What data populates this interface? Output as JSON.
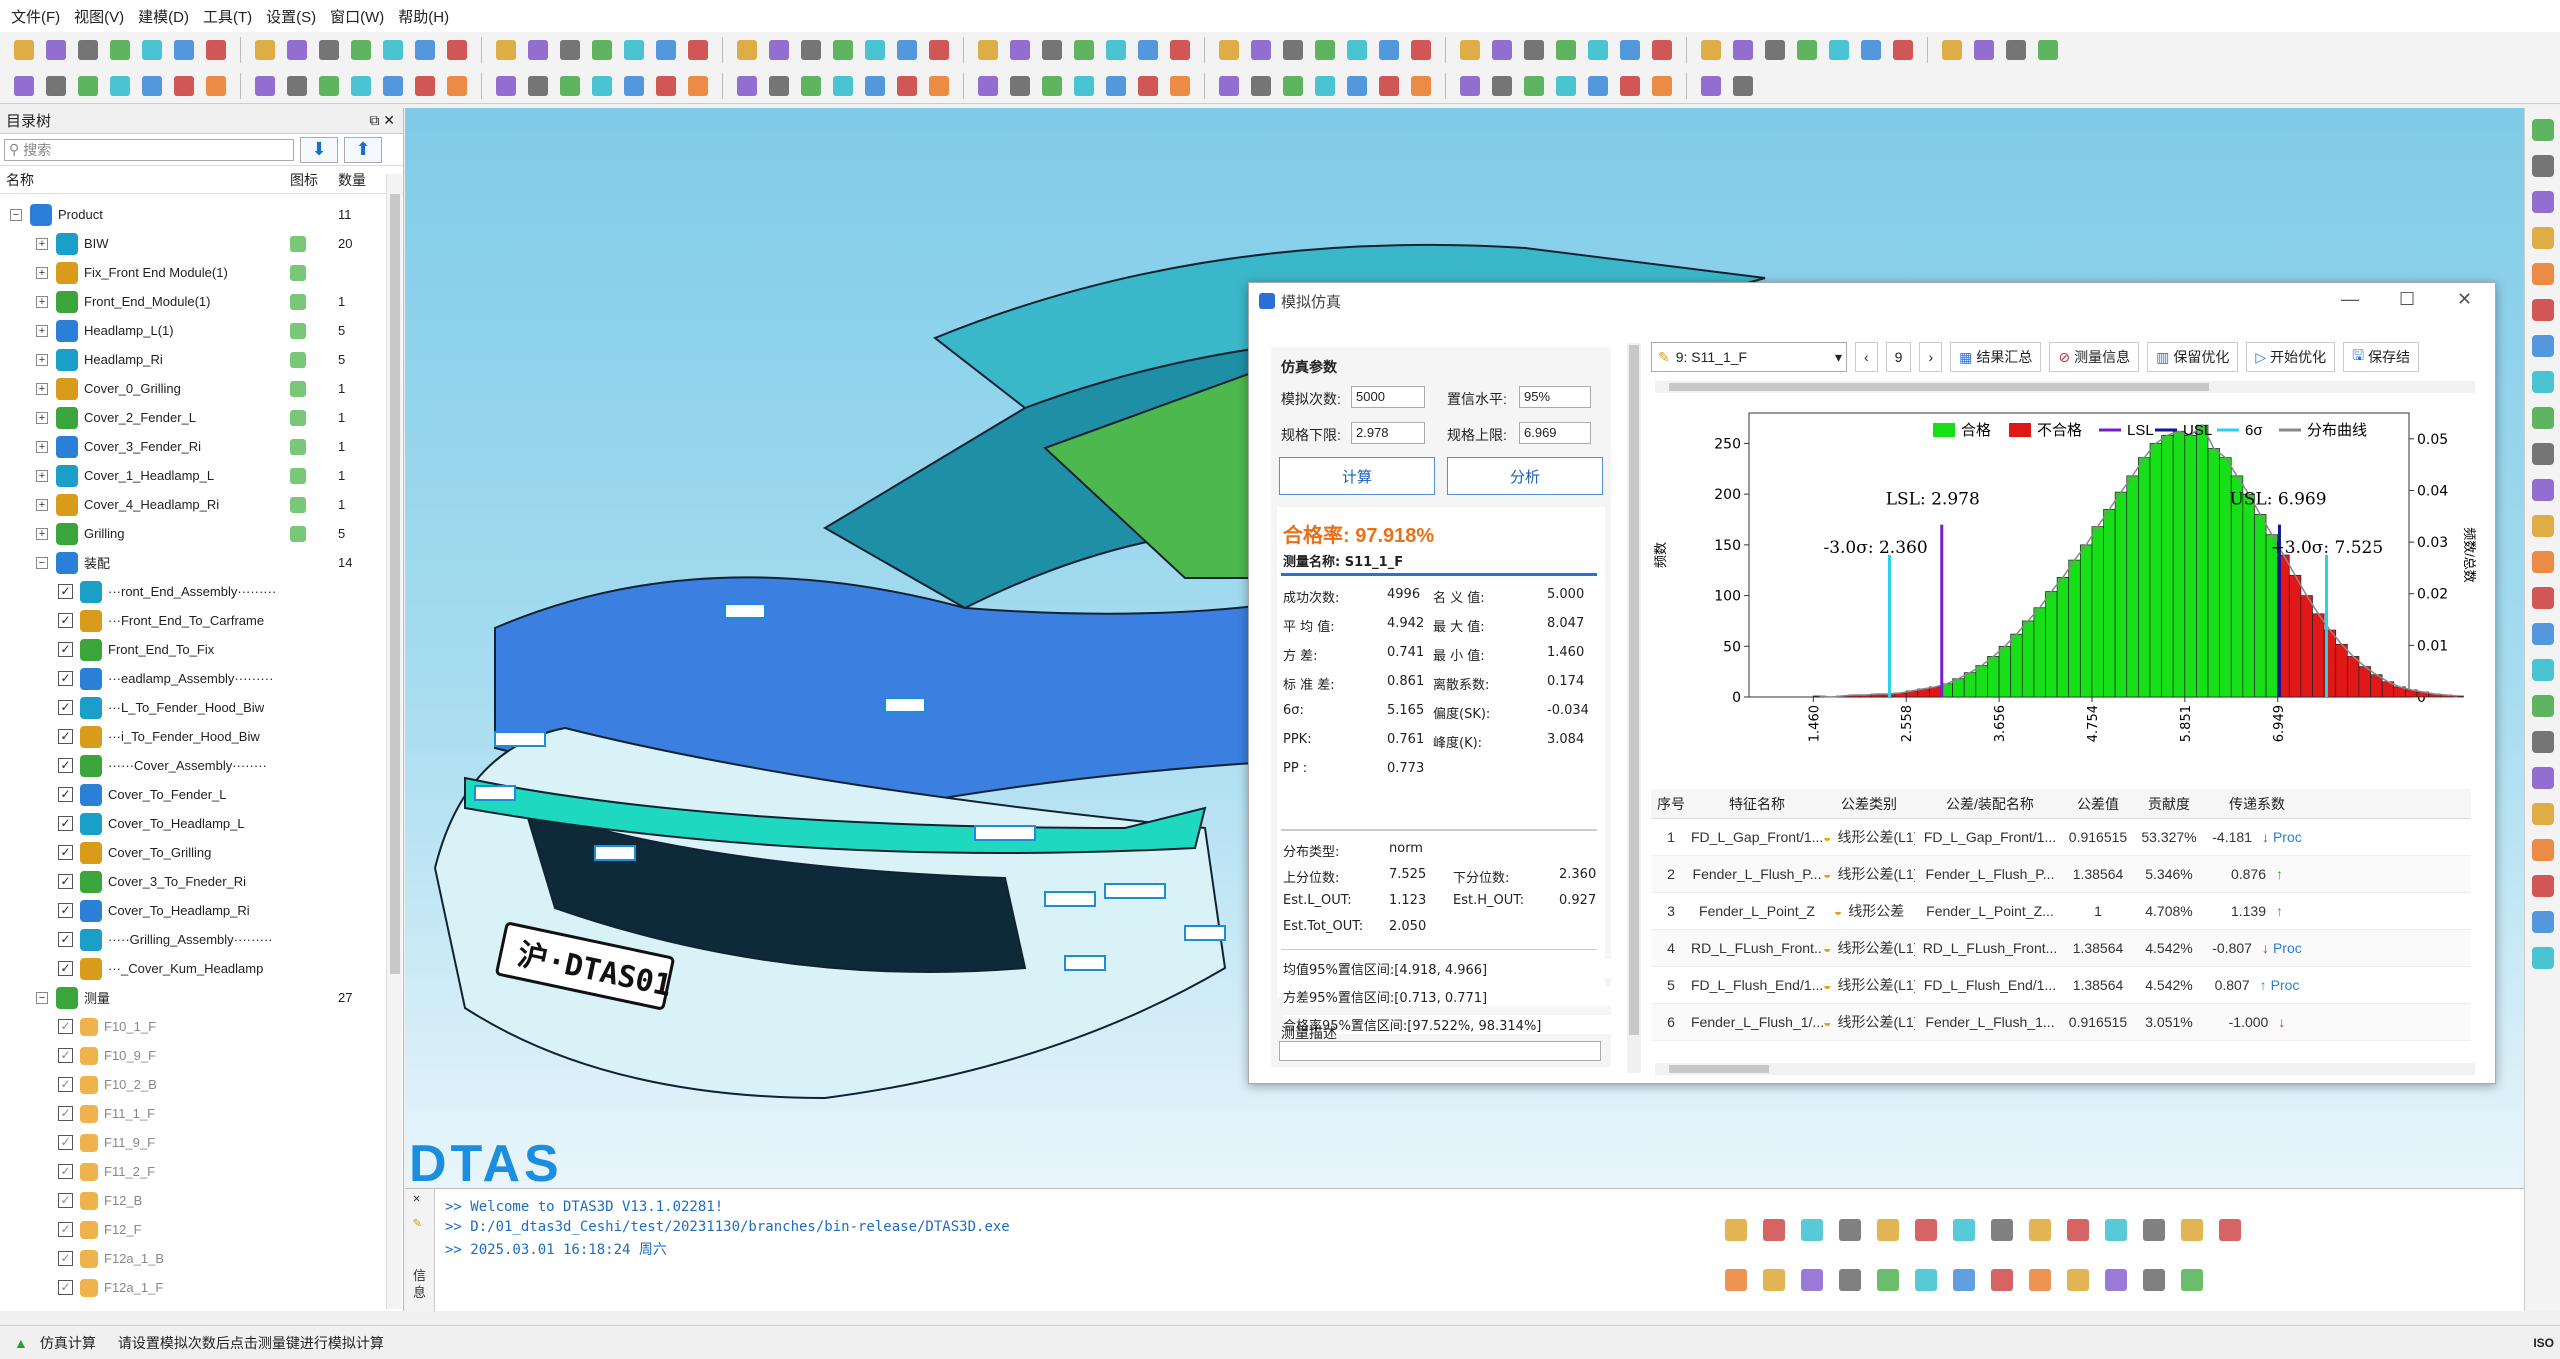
{
  "menu": [
    "文件(F)",
    "视图(V)",
    "建模(D)",
    "工具(T)",
    "设置(S)",
    "窗口(W)",
    "帮助(H)"
  ],
  "left_panel": {
    "title": "目录树",
    "search_placeholder": "搜索",
    "columns": {
      "name": "名称",
      "icon": "图标",
      "count": "数量"
    },
    "tree": [
      {
        "label": "Product",
        "count": "11",
        "level": 0,
        "exp": "−"
      },
      {
        "label": "BIW",
        "count": "20",
        "level": 1,
        "exp": "+"
      },
      {
        "label": "Fix_Front End Module(1)",
        "count": "",
        "level": 1,
        "exp": "+"
      },
      {
        "label": "Front_End_Module(1)",
        "count": "1",
        "level": 1,
        "exp": "+"
      },
      {
        "label": "Headlamp_L(1)",
        "count": "5",
        "level": 1,
        "exp": "+"
      },
      {
        "label": "Headlamp_Ri",
        "count": "5",
        "level": 1,
        "exp": "+"
      },
      {
        "label": "Cover_0_Grilling",
        "count": "1",
        "level": 1,
        "exp": "+"
      },
      {
        "label": "Cover_2_Fender_L",
        "count": "1",
        "level": 1,
        "exp": "+"
      },
      {
        "label": "Cover_3_Fender_Ri",
        "count": "1",
        "level": 1,
        "exp": "+"
      },
      {
        "label": "Cover_1_Headlamp_L",
        "count": "1",
        "level": 1,
        "exp": "+"
      },
      {
        "label": "Cover_4_Headlamp_Ri",
        "count": "1",
        "level": 1,
        "exp": "+"
      },
      {
        "label": "Grilling",
        "count": "5",
        "level": 1,
        "exp": "+"
      },
      {
        "label": "装配",
        "count": "14",
        "level": 1,
        "exp": "−"
      },
      {
        "label": "···ront_End_Assembly·········",
        "count": "",
        "level": 2,
        "chk": true
      },
      {
        "label": "···Front_End_To_Carframe",
        "count": "",
        "level": 2,
        "chk": true
      },
      {
        "label": "Front_End_To_Fix",
        "count": "",
        "level": 2,
        "chk": true
      },
      {
        "label": "···eadlamp_Assembly·········",
        "count": "",
        "level": 2,
        "chk": true
      },
      {
        "label": "···L_To_Fender_Hood_Biw",
        "count": "",
        "level": 2,
        "chk": true
      },
      {
        "label": "···i_To_Fender_Hood_Biw",
        "count": "",
        "level": 2,
        "chk": true
      },
      {
        "label": "······Cover_Assembly········",
        "count": "",
        "level": 2,
        "chk": true
      },
      {
        "label": "Cover_To_Fender_L",
        "count": "",
        "level": 2,
        "chk": true
      },
      {
        "label": "Cover_To_Headlamp_L",
        "count": "",
        "level": 2,
        "chk": true
      },
      {
        "label": "Cover_To_Grilling",
        "count": "",
        "level": 2,
        "chk": true
      },
      {
        "label": "Cover_3_To_Fneder_Ri",
        "count": "",
        "level": 2,
        "chk": true
      },
      {
        "label": "Cover_To_Headlamp_Ri",
        "count": "",
        "level": 2,
        "chk": true
      },
      {
        "label": "·····Grilling_Assembly·········",
        "count": "",
        "level": 2,
        "chk": true
      },
      {
        "label": "···_Cover_Kum_Headlamp",
        "count": "",
        "level": 2,
        "chk": true
      },
      {
        "label": "测量",
        "count": "27",
        "level": 1,
        "exp": "−"
      },
      {
        "label": "F10_1_F",
        "count": "",
        "level": 2,
        "chk": true
      },
      {
        "label": "F10_9_F",
        "count": "",
        "level": 2,
        "chk": true
      },
      {
        "label": "F10_2_B",
        "count": "",
        "level": 2,
        "chk": true
      },
      {
        "label": "F11_1_F",
        "count": "",
        "level": 2,
        "chk": true
      },
      {
        "label": "F11_9_F",
        "count": "",
        "level": 2,
        "chk": true
      },
      {
        "label": "F11_2_F",
        "count": "",
        "level": 2,
        "chk": true
      },
      {
        "label": "F12_B",
        "count": "",
        "level": 2,
        "chk": true
      },
      {
        "label": "F12_F",
        "count": "",
        "level": 2,
        "chk": true
      },
      {
        "label": "F12a_1_B",
        "count": "",
        "level": 2,
        "chk": true
      },
      {
        "label": "F12a_1_F",
        "count": "",
        "level": 2,
        "chk": true
      }
    ]
  },
  "viewport": {
    "logo": "DTAS",
    "plate": "沪·DTAS01"
  },
  "console": {
    "lines": [
      ">>  Welcome  to  DTAS3D  V13.1.02281!",
      ">>  D:/01_dtas3d_Ceshi/test/20231130/branches/bin-release/DTAS3D.exe",
      ">>  2025.03.01  16:18:24  周六"
    ],
    "side_label": "信息"
  },
  "status": {
    "mode": "仿真计算",
    "message": "请设置模拟次数后点击测量键进行模拟计算"
  },
  "dialog": {
    "title": "模拟仿真",
    "params": {
      "heading": "仿真参数",
      "sim_count_label": "模拟次数:",
      "sim_count": "5000",
      "conf_label": "置信水平:",
      "conf": "95%",
      "lsl_label": "规格下限:",
      "lsl": "2.978",
      "usl_label": "规格上限:",
      "usl": "6.969",
      "calc": "计算",
      "analyze": "分析"
    },
    "pass_rate": "合格率: 97.918%",
    "measure_name": "测量名称: S11_1_F",
    "stats": [
      [
        "成功次数:",
        "4996",
        "名 义 值:",
        "5.000"
      ],
      [
        "平 均 值:",
        "4.942",
        "最 大 值:",
        "8.047"
      ],
      [
        "方     差:",
        "0.741",
        "最 小 值:",
        "1.460"
      ],
      [
        "标 准 差:",
        "0.861",
        "离散系数:",
        "0.174"
      ],
      [
        "6σ:",
        "5.165",
        "偏度(SK):",
        "-0.034"
      ],
      [
        "PPK:",
        "0.761",
        "峰度(K):",
        "3.084"
      ],
      [
        "PP :",
        "0.773",
        "",
        ""
      ]
    ],
    "dist": [
      [
        "分布类型:",
        "norm",
        "",
        ""
      ],
      [
        "上分位数:",
        "7.525",
        "下分位数:",
        "2.360"
      ],
      [
        "Est.L_OUT:",
        "1.123",
        "Est.H_OUT:",
        "0.927"
      ],
      [
        "Est.Tot_OUT:",
        "2.050",
        "",
        ""
      ]
    ],
    "ci": [
      "均值95%置信区间:[4.918, 4.966]",
      "方差95%置信区间:[0.713, 0.771]",
      "合格率95%置信区间:[97.522%, 98.314%]"
    ],
    "desc_label": "测量描述",
    "toolbar": {
      "selector": "9: S11_1_F",
      "page": "9",
      "summary": "结果汇总",
      "measure_info": "测量信息",
      "keep_opt": "保留优化",
      "start_opt": "开始优化",
      "save": "保存结"
    },
    "table": {
      "headers": [
        "序号",
        "特征名称",
        "公差类别",
        "公差/装配名称",
        "公差值",
        "贡献度",
        "传递系数"
      ],
      "rows": [
        [
          "1",
          "FD_L_Gap_Front/1...",
          "线形公差(L1)",
          "FD_L_Gap_Front/1...",
          "0.916515",
          "53.327%",
          "-4.181",
          "down",
          "Proc"
        ],
        [
          "2",
          "Fender_L_Flush_P...",
          "线形公差(L1)",
          "Fender_L_Flush_P...",
          "1.38564",
          "5.346%",
          "0.876",
          "up",
          ""
        ],
        [
          "3",
          "Fender_L_Point_Z",
          "线形公差",
          "Fender_L_Point_Z...",
          "1",
          "4.708%",
          "1.139",
          "up",
          ""
        ],
        [
          "4",
          "RD_L_FLush_Front...",
          "线形公差(L1)",
          "RD_L_FLush_Front...",
          "1.38564",
          "4.542%",
          "-0.807",
          "down",
          "Proc"
        ],
        [
          "5",
          "FD_L_Flush_End/1...",
          "线形公差(L1)",
          "FD_L_Flush_End/1...",
          "1.38564",
          "4.542%",
          "0.807",
          "up",
          "Proc"
        ],
        [
          "6",
          "Fender_L_Flush_1/...",
          "线形公差(L1)",
          "Fender_L_Flush_1...",
          "0.916515",
          "3.051%",
          "-1.000",
          "down",
          ""
        ]
      ]
    }
  },
  "chart_data": {
    "type": "bar",
    "title": "",
    "xlabel": "",
    "ylabel": "频数",
    "y2label": "频数/总数",
    "xlim": [
      0.7,
      8.5
    ],
    "ylim": [
      0,
      280
    ],
    "y2lim": [
      0,
      0.055
    ],
    "yticks": [
      0,
      50,
      100,
      150,
      200,
      250
    ],
    "y2ticks": [
      0,
      0.01,
      0.02,
      0.03,
      0.04,
      0.05
    ],
    "xticks": [
      "1.460",
      "2.558",
      "3.656",
      "4.754",
      "5.851",
      "6.949"
    ],
    "xtick_values": [
      1.46,
      2.558,
      3.656,
      4.754,
      5.851,
      6.949
    ],
    "legend": [
      "合格",
      "不合格",
      "LSL",
      "USL",
      "6σ",
      "分布曲线"
    ],
    "legend_position": "top",
    "bin_start": 1.46,
    "bin_width": 0.1372,
    "counts": [
      1,
      0,
      1,
      2,
      2,
      3,
      3,
      4,
      6,
      8,
      10,
      13,
      18,
      24,
      31,
      40,
      50,
      62,
      75,
      88,
      104,
      118,
      135,
      150,
      168,
      185,
      202,
      218,
      236,
      250,
      258,
      262,
      258,
      268,
      245,
      236,
      218,
      200,
      180,
      160,
      140,
      120,
      100,
      82,
      66,
      52,
      40,
      30,
      22,
      15,
      10,
      7,
      5,
      3,
      2,
      1
    ],
    "lsl": 2.978,
    "usl": 6.969,
    "sigma_low": 2.36,
    "sigma_high": 7.525,
    "annotations": [
      "LSL: 2.978",
      "USL: 6.969",
      "-3.0σ: 2.360",
      "+3.0σ: 7.525"
    ],
    "colors": {
      "pass": "#18e018",
      "fail": "#e01818",
      "lsl": "#7a1cc8",
      "usl": "#141496",
      "sigma": "#29d0e8",
      "curve": "#888888"
    }
  }
}
